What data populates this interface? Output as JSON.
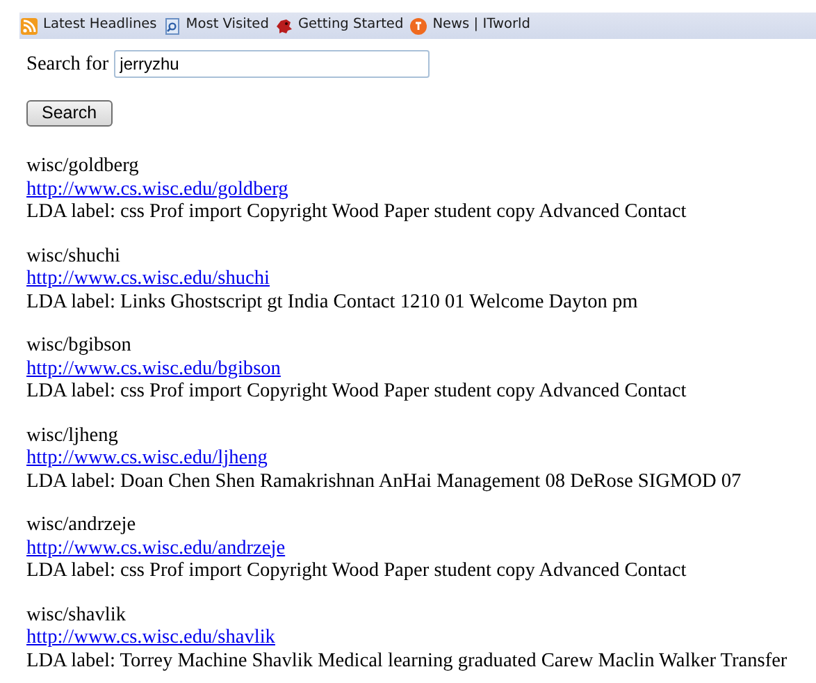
{
  "bookmarks_bar": [
    {
      "kind": "rss",
      "label": "Latest Headlines"
    },
    {
      "kind": "page",
      "label": "Most Visited"
    },
    {
      "kind": "dragon",
      "label": "Getting Started"
    },
    {
      "kind": "circle",
      "label": "News | ITworld"
    }
  ],
  "search": {
    "label": "Search for",
    "value": "jerryzhu",
    "button": "Search"
  },
  "results": [
    {
      "name": "wisc/goldberg",
      "url": "http://www.cs.wisc.edu/goldberg",
      "label": "LDA label: css Prof import Copyright Wood Paper student copy Advanced Contact"
    },
    {
      "name": "wisc/shuchi",
      "url": "http://www.cs.wisc.edu/shuchi",
      "label": "LDA label: Links Ghostscript gt India Contact 1210 01 Welcome Dayton pm"
    },
    {
      "name": "wisc/bgibson",
      "url": "http://www.cs.wisc.edu/bgibson",
      "label": "LDA label: css Prof import Copyright Wood Paper student copy Advanced Contact"
    },
    {
      "name": "wisc/ljheng",
      "url": "http://www.cs.wisc.edu/ljheng",
      "label": "LDA label: Doan Chen Shen Ramakrishnan AnHai Management 08 DeRose SIGMOD 07"
    },
    {
      "name": "wisc/andrzeje",
      "url": "http://www.cs.wisc.edu/andrzeje",
      "label": "LDA label: css Prof import Copyright Wood Paper student copy Advanced Contact"
    },
    {
      "name": "wisc/shavlik",
      "url": "http://www.cs.wisc.edu/shavlik",
      "label": "LDA label: Torrey Machine Shavlik Medical learning graduated Carew Maclin Walker Transfer"
    }
  ]
}
